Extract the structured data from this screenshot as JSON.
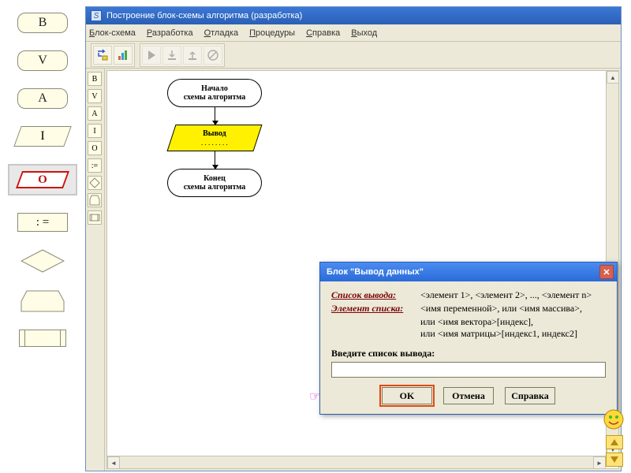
{
  "palette": {
    "B": "B",
    "V": "V",
    "A": "A",
    "I": "I",
    "O": "O",
    "assign": ": ="
  },
  "app": {
    "title": "Построение блок-схемы алгоритма (разработка)",
    "menu": [
      "Блок-схема",
      "Разработка",
      "Отладка",
      "Процедуры",
      "Справка",
      "Выход"
    ]
  },
  "flow": {
    "start": "Начало\nсхемы алгоритма",
    "io": "Вывод",
    "io_sub": ". . . . . . . .",
    "end": "Конец\nсхемы алгоритма"
  },
  "dialog": {
    "title": "Блок \"Вывод данных\"",
    "label_list": "Список вывода:",
    "val_list": "<элемент 1>, <элемент 2>, ..., <элемент n>",
    "label_elem": "Элемент списка:",
    "val_elem": "<имя переменной>,  или  <имя массива>,",
    "line3": "или  <имя вектора>[индекс],",
    "line4": "или  <имя матрицы>[индекс1, индекс2]",
    "prompt": "Введите список вывода:",
    "input_value": "",
    "ok": "OK",
    "cancel": "Отмена",
    "help": "Справка"
  }
}
